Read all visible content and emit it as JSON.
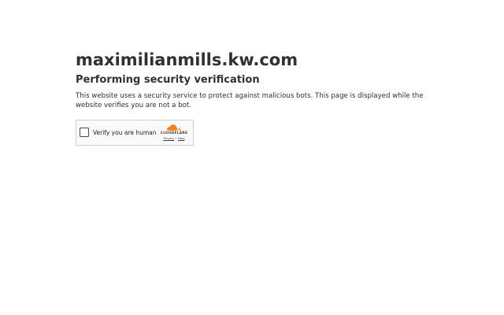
{
  "page": {
    "site_title": "maximilianmills.kw.com",
    "subtitle": "Performing security verification",
    "description": "This website uses a security service to protect against malicious bots. This page is displayed while the website verifies you are not a bot."
  },
  "widget": {
    "checkbox_label": "Verify you are human",
    "checked": false,
    "brand_name": "CLOUDFLARE",
    "brand_icon": "cloud-icon",
    "privacy_link": "Privacy",
    "separator": "•",
    "help_link": "Help"
  },
  "colors": {
    "text": "#313131",
    "cloud_orange": "#f48120",
    "cloud_light_orange": "#faad3f",
    "widget_border": "#d0d0d0",
    "widget_bg": "#fafafa"
  }
}
